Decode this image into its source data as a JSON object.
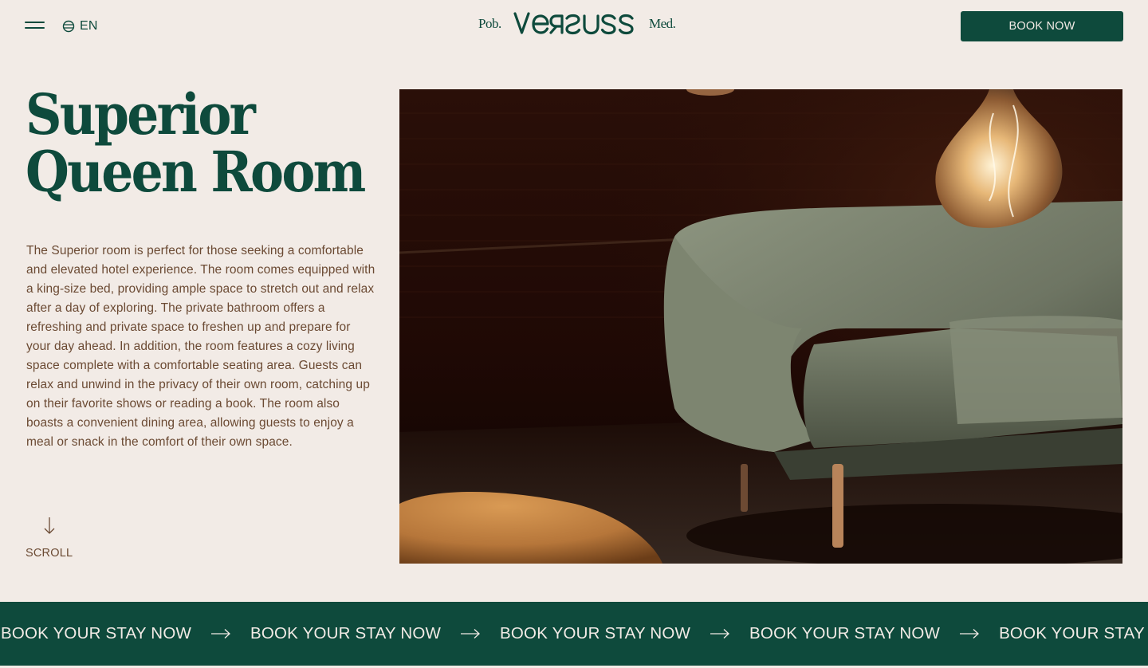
{
  "header": {
    "language": "EN",
    "brand_prefix": "Pob.",
    "brand_logo": "VERSUS",
    "brand_suffix": "Med.",
    "book_label": "BOOK NOW"
  },
  "room": {
    "title_line1": "Superior",
    "title_line2": "Queen Room",
    "description": "The Superior room is perfect for those seeking a comfortable and elevated hotel experience. The room comes equipped with a king-size bed, providing ample space to stretch out and relax after a day of exploring. The private bathroom offers a refreshing and private space to freshen up and prepare for your day ahead. In addition, the room features a cozy living space complete with a comfortable seating area. Guests can relax and unwind in the privacy of their own room, catching up on their favorite shows or reading a book. The room also boasts a convenient dining area, allowing guests to enjoy a meal or snack in the comfort of their own space."
  },
  "scroll": {
    "label": "SCROLL",
    "icon": "arrow-down-icon"
  },
  "marquee": {
    "items": [
      "BOOK YOUR STAY NOW",
      "BOOK YOUR STAY NOW",
      "BOOK YOUR STAY NOW",
      "BOOK YOUR STAY NOW",
      "BOOK YOUR STAY NOW"
    ],
    "icon": "arrow-right-icon"
  },
  "icons": {
    "menu": "hamburger-menu-icon",
    "language": "globe-icon"
  },
  "colors": {
    "primary": "#0e4a3c",
    "background": "#f2ebe6",
    "body_text": "#6b4a33"
  }
}
